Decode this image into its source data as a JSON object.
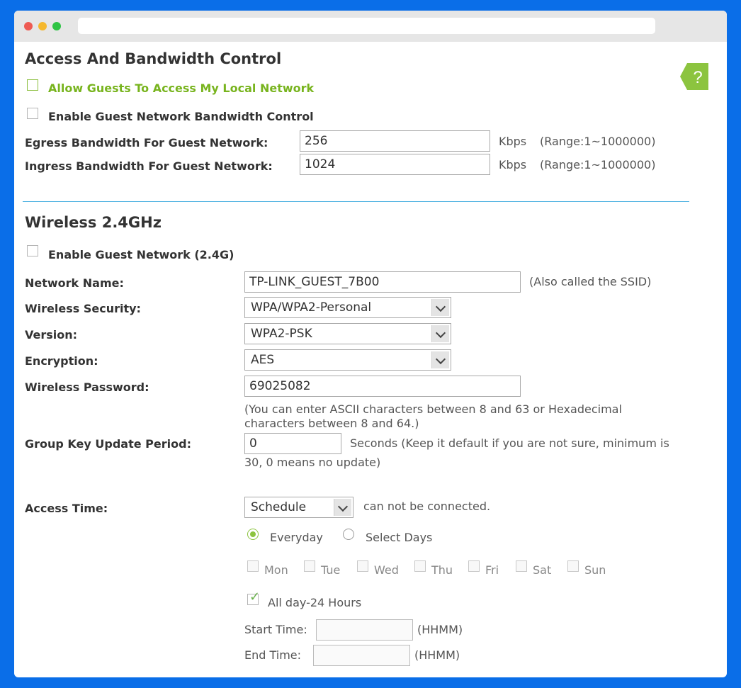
{
  "access": {
    "title": "Access And Bandwidth Control",
    "allow_guests_label": "Allow Guests To Access My Local Network",
    "enable_bw_label": "Enable Guest Network Bandwidth Control",
    "egress_label": "Egress Bandwidth For Guest Network:",
    "egress_value": "256",
    "ingress_label": "Ingress Bandwidth For Guest Network:",
    "ingress_value": "1024",
    "unit": "Kbps",
    "range": "(Range:1~1000000)"
  },
  "wireless": {
    "title": "Wireless 2.4GHz",
    "enable_label": "Enable Guest Network (2.4G)",
    "network_name_label": "Network Name:",
    "network_name_value": "TP-LINK_GUEST_7B00",
    "ssid_hint": "(Also called the SSID)",
    "security_label": "Wireless Security:",
    "security_value": "WPA/WPA2-Personal",
    "version_label": "Version:",
    "version_value": "WPA2-PSK",
    "encryption_label": "Encryption:",
    "encryption_value": "AES",
    "password_label": "Wireless Password:",
    "password_value": "69025082",
    "password_hint_1": "(You can enter ASCII characters between 8 and 63 or Hexadecimal",
    "password_hint_2": "characters between 8 and 64.)",
    "group_key_label": "Group Key Update Period:",
    "group_key_value": "0",
    "group_key_hint_1": "Seconds (Keep it default if you are not sure, minimum is",
    "group_key_hint_2": "30, 0 means no update)",
    "access_time_label": "Access Time:",
    "access_time_value": "Schedule",
    "access_time_hint": "can not be connected.",
    "everyday_label": "Everyday",
    "select_days_label": "Select Days",
    "days": [
      "Mon",
      "Tue",
      "Wed",
      "Thu",
      "Fri",
      "Sat",
      "Sun"
    ],
    "all_day_label": "All day-24 Hours",
    "start_time_label": "Start Time:",
    "end_time_label": "End Time:",
    "time_format": "(HHMM)"
  },
  "help_icon_glyph": "?",
  "colors": {
    "accent_green": "#78b41e",
    "background_blue": "#0a6ee8",
    "divider_blue": "#4ab0e0"
  }
}
